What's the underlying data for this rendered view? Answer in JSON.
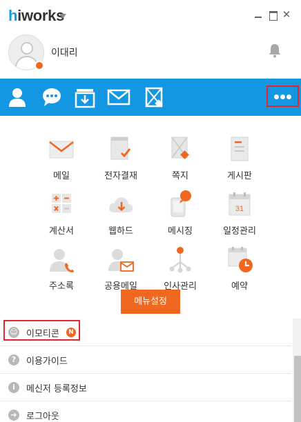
{
  "app": {
    "brand": "hiworks",
    "brand_prefix": "h",
    "brand_rest": "iworks"
  },
  "profile": {
    "name": "이대리"
  },
  "toolbar": {
    "icons": [
      "contacts-icon",
      "chat-icon",
      "download-box-icon",
      "mail-icon",
      "note-icon"
    ],
    "more": "more-icon"
  },
  "apps": [
    {
      "label": "메일",
      "icon": "mail-icon"
    },
    {
      "label": "전자결재",
      "icon": "approval-icon"
    },
    {
      "label": "쪽지",
      "icon": "note-icon"
    },
    {
      "label": "게시판",
      "icon": "board-icon"
    },
    {
      "label": "계산서",
      "icon": "calculator-icon"
    },
    {
      "label": "웹하드",
      "icon": "cloud-download-icon"
    },
    {
      "label": "메시징",
      "icon": "mobile-message-icon"
    },
    {
      "label": "일정관리",
      "icon": "calendar-icon"
    },
    {
      "label": "주소록",
      "icon": "address-book-icon"
    },
    {
      "label": "공용메일",
      "icon": "shared-mail-icon"
    },
    {
      "label": "인사관리",
      "icon": "org-chart-icon"
    },
    {
      "label": "예약",
      "icon": "reservation-icon"
    }
  ],
  "menu_settings_label": "메뉴설정",
  "list": [
    {
      "label": "이모티콘",
      "icon": "smile-icon",
      "badge": "N"
    },
    {
      "label": "이용가이드",
      "icon": "question-icon"
    },
    {
      "label": "메신저 등록정보",
      "icon": "info-icon"
    },
    {
      "label": "로그아웃",
      "icon": "logout-icon"
    }
  ],
  "colors": {
    "toolbar_blue": "#1497e3",
    "accent_orange": "#f06820",
    "highlight_red": "#e5252a"
  }
}
